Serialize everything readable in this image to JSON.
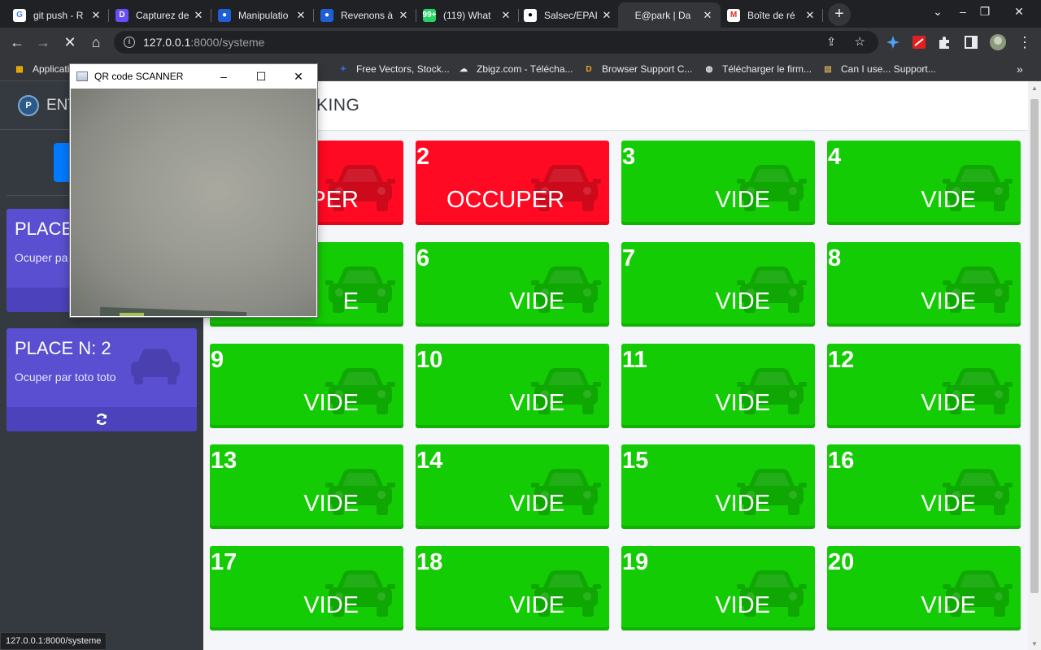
{
  "browser": {
    "tabs": [
      {
        "title": "git push - R",
        "icon": "google-icon",
        "color": "#ffffff",
        "fg": "#4285f4",
        "glyph": "G"
      },
      {
        "title": "Capturez de",
        "icon": "capture-app-icon",
        "color": "#6a4cff",
        "fg": "#ffffff",
        "glyph": "D"
      },
      {
        "title": "Manipulatio",
        "icon": "blue-app-icon",
        "color": "#1f5fd6",
        "fg": "#ffffff",
        "glyph": "●"
      },
      {
        "title": "Revenons à",
        "icon": "blue-app-icon",
        "color": "#1f5fd6",
        "fg": "#ffffff",
        "glyph": "●"
      },
      {
        "title": "(119) What",
        "icon": "whatsapp-icon",
        "color": "#25d366",
        "fg": "#ffffff",
        "glyph": "99+"
      },
      {
        "title": "Salsec/EPAI",
        "icon": "github-icon",
        "color": "#ffffff",
        "fg": "#000000",
        "glyph": "●"
      },
      {
        "title": "E@park | Da",
        "icon": "",
        "color": "",
        "fg": "",
        "glyph": ""
      },
      {
        "title": "Boîte de ré",
        "icon": "gmail-icon",
        "color": "#ffffff",
        "fg": "#d93025",
        "glyph": "M"
      }
    ],
    "active_tab": 6,
    "url_host": "127.0.0.1",
    "url_path": ":8000/systeme",
    "bookmarks": [
      {
        "label": "Applicati",
        "icon": "apps-grid-icon"
      },
      {
        "label": "Free Vectors, Stock...",
        "icon": "freepik-icon"
      },
      {
        "label": "Zbigz.com - Télécha...",
        "icon": "cloud-icon"
      },
      {
        "label": "Browser Support C...",
        "icon": "d-icon"
      },
      {
        "label": "Télécharger le firm...",
        "icon": "globe-icon"
      },
      {
        "label": "Can I use... Support...",
        "icon": "caniuse-icon"
      }
    ],
    "status_url": "127.0.0.1:8000/systeme"
  },
  "app": {
    "brand": "ENT",
    "page_title": "KING",
    "sidebar_button": "S",
    "places": [
      {
        "title": "PLACE",
        "subtitle": "Ocuper pa"
      },
      {
        "title": "PLACE N: 2",
        "subtitle": "Ocuper par toto toto"
      }
    ],
    "slots": [
      {
        "num": "",
        "status": "PER",
        "state": "busy"
      },
      {
        "num": "2",
        "status": "OCCUPER",
        "state": "busy"
      },
      {
        "num": "3",
        "status": "VIDE",
        "state": "free"
      },
      {
        "num": "4",
        "status": "VIDE",
        "state": "free"
      },
      {
        "num": "",
        "status": "E",
        "state": "free"
      },
      {
        "num": "6",
        "status": "VIDE",
        "state": "free"
      },
      {
        "num": "7",
        "status": "VIDE",
        "state": "free"
      },
      {
        "num": "8",
        "status": "VIDE",
        "state": "free"
      },
      {
        "num": "9",
        "status": "VIDE",
        "state": "free"
      },
      {
        "num": "10",
        "status": "VIDE",
        "state": "free"
      },
      {
        "num": "11",
        "status": "VIDE",
        "state": "free"
      },
      {
        "num": "12",
        "status": "VIDE",
        "state": "free"
      },
      {
        "num": "13",
        "status": "VIDE",
        "state": "free"
      },
      {
        "num": "14",
        "status": "VIDE",
        "state": "free"
      },
      {
        "num": "15",
        "status": "VIDE",
        "state": "free"
      },
      {
        "num": "16",
        "status": "VIDE",
        "state": "free"
      },
      {
        "num": "17",
        "status": "VIDE",
        "state": "free"
      },
      {
        "num": "18",
        "status": "VIDE",
        "state": "free"
      },
      {
        "num": "19",
        "status": "VIDE",
        "state": "free"
      },
      {
        "num": "20",
        "status": "VIDE",
        "state": "free"
      }
    ],
    "colors": {
      "free": "#14cc04",
      "busy": "#ff0a22",
      "place_card": "#5a4fd0",
      "sidebar": "#343a40"
    }
  },
  "qr_window": {
    "title": "QR code SCANNER"
  }
}
